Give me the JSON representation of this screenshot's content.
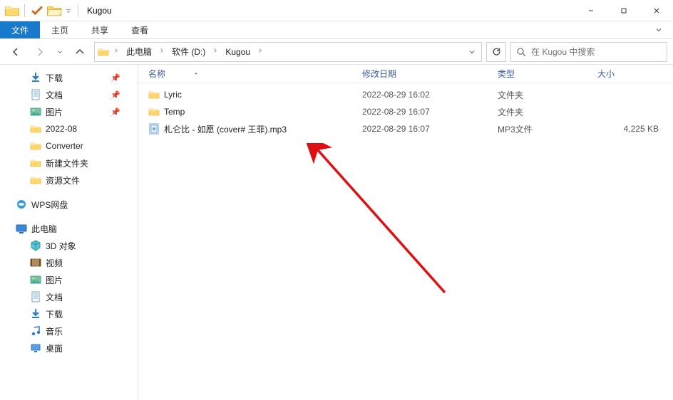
{
  "window": {
    "title": "Kugou"
  },
  "ribbon": {
    "tabs": [
      "文件",
      "主页",
      "共享",
      "查看"
    ],
    "active_index": 0
  },
  "breadcrumb": {
    "items": [
      "此电脑",
      "软件 (D:)",
      "Kugou"
    ]
  },
  "search": {
    "placeholder": "在 Kugou 中搜索"
  },
  "nav_pane": {
    "quick_access": [
      {
        "label": "下载",
        "icon": "download",
        "pinned": true
      },
      {
        "label": "文档",
        "icon": "document",
        "pinned": true
      },
      {
        "label": "图片",
        "icon": "picture",
        "pinned": true
      },
      {
        "label": "2022-08",
        "icon": "folder",
        "pinned": false
      },
      {
        "label": "Converter",
        "icon": "folder",
        "pinned": false
      },
      {
        "label": "新建文件夹",
        "icon": "folder",
        "pinned": false
      },
      {
        "label": "资源文件",
        "icon": "folder",
        "pinned": false
      }
    ],
    "wps": {
      "label": "WPS网盘"
    },
    "this_pc": {
      "label": "此电脑"
    },
    "this_pc_children": [
      {
        "label": "3D 对象",
        "icon": "3d"
      },
      {
        "label": "视频",
        "icon": "video"
      },
      {
        "label": "图片",
        "icon": "picture"
      },
      {
        "label": "文档",
        "icon": "document"
      },
      {
        "label": "下载",
        "icon": "download"
      },
      {
        "label": "音乐",
        "icon": "music"
      },
      {
        "label": "桌面",
        "icon": "desktop"
      }
    ]
  },
  "columns": {
    "name": "名称",
    "date": "修改日期",
    "type": "类型",
    "size": "大小"
  },
  "files": [
    {
      "name": "Lyric",
      "date": "2022-08-29 16:02",
      "type": "文件夹",
      "size": "",
      "icon": "folder"
    },
    {
      "name": "Temp",
      "date": "2022-08-29 16:07",
      "type": "文件夹",
      "size": "",
      "icon": "folder"
    },
    {
      "name": "札仑比 - 如愿 (cover# 王菲).mp3",
      "date": "2022-08-29 16:07",
      "type": "MP3文件",
      "size": "4,225 KB",
      "icon": "mp3"
    }
  ]
}
